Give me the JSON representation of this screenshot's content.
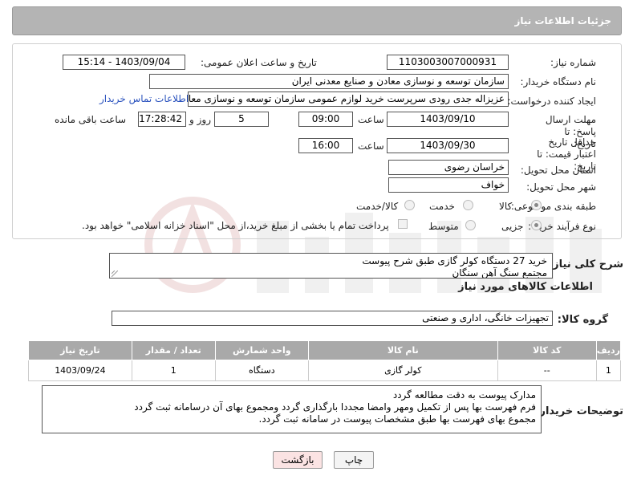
{
  "header": {
    "title": "جزئیات اطلاعات نیاز"
  },
  "form": {
    "need_number_label": "شماره نیاز:",
    "need_number": "1103003007000931",
    "announce_label": "تاریخ و ساعت اعلان عمومی:",
    "announce_value": "1403/09/04 - 15:14",
    "buyer_org_label": "نام دستگاه خریدار:",
    "buyer_org": "سازمان توسعه و نوسازی معادن و صنایع معدنی ایران",
    "requester_label": "ایجاد کننده درخواست:",
    "requester": "عزیزاله جدی رودی سرپرست خرید لوازم عمومی  سازمان توسعه و نوسازی معادن",
    "contact_link": "اطلاعات تماس خریدار",
    "reply_deadline_label": "مهلت ارسال پاسخ: تا تاریخ:",
    "reply_date": "1403/09/10",
    "time_label": "ساعت",
    "reply_time": "09:00",
    "days_value": "5",
    "days_label": "روز و",
    "remaining_time": "17:28:42",
    "remaining_label": "ساعت باقی مانده",
    "price_validity_label": "حداقل تاریخ اعتبار قیمت: تا تاریخ:",
    "price_date": "1403/09/30",
    "price_time": "16:00",
    "province_label": "استان محل تحویل:",
    "province": "خراسان رضوی",
    "city_label": "شهر محل تحویل:",
    "city": "خواف",
    "category_label": "طبقه بندی موضوعی:",
    "category_options": [
      "کالا",
      "خدمت",
      "کالا/خدمت"
    ],
    "process_label": "نوع فرآیند خرید :",
    "process_options": [
      "جزیی",
      "متوسط"
    ],
    "payment_note": "پرداخت تمام یا بخشی از مبلغ خرید،از محل \"اسناد خزانه اسلامی\" خواهد بود."
  },
  "summary": {
    "label": "شرح کلی نیاز:",
    "text_line1": "خرید 27 دستگاه کولر گازی طبق شرح پیوست",
    "text_line2": "مجتمع سنگ آهن سنگان"
  },
  "goods": {
    "section_title": "اطلاعات کالاهای مورد نیاز",
    "group_label": "گروه کالا:",
    "group_value": "تجهیزات خانگی، اداری و صنعتی",
    "columns": [
      "ردیف",
      "کد کالا",
      "نام کالا",
      "واحد شمارش",
      "تعداد / مقدار",
      "تاریخ نیاز"
    ],
    "rows": [
      {
        "row": "1",
        "code": "--",
        "name": "کولر گازی",
        "unit": "دستگاه",
        "qty": "1",
        "date": "1403/09/24"
      }
    ]
  },
  "buyer_notes": {
    "label": "توضیحات خریدار:",
    "line1": "مدارک پیوست به دقت مطالعه گردد",
    "line2": "فرم فهرست بها پس از تکمیل ومهر وامضا مجددا بارگذاری گردد ومجموع بهای آن درسامانه ثبت گردد",
    "line3": "مجموع بهای فهرست بها طبق مشخصات پیوست در سامانه ثبت گردد."
  },
  "buttons": {
    "print": "چاپ",
    "back": "بازگشت"
  },
  "colors": {
    "header_bg": "#b4b4b4",
    "link": "#2a52be",
    "back_btn_bg": "#fbe3e3"
  }
}
